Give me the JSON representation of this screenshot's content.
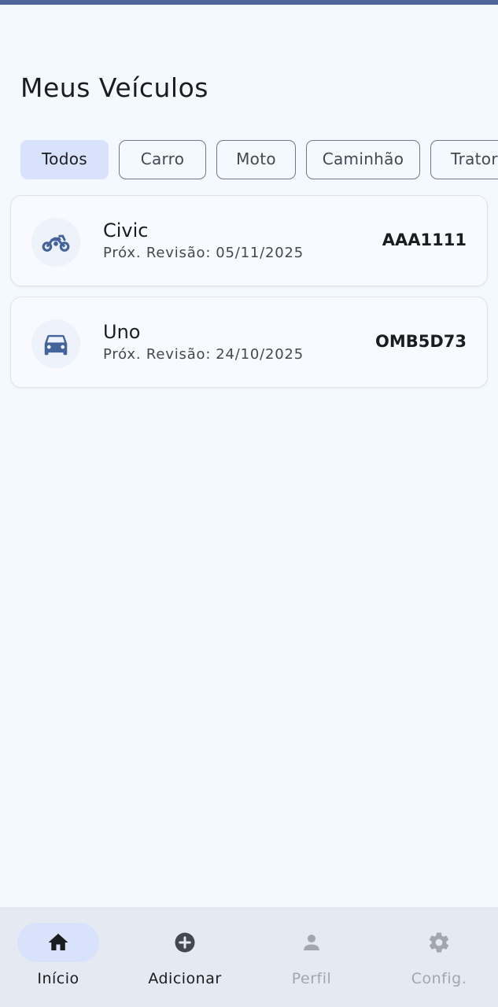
{
  "page": {
    "title": "Meus Veículos"
  },
  "filters": [
    {
      "label": "Todos",
      "selected": true
    },
    {
      "label": "Carro",
      "selected": false
    },
    {
      "label": "Moto",
      "selected": false
    },
    {
      "label": "Caminhão",
      "selected": false
    },
    {
      "label": "Trator",
      "selected": false
    }
  ],
  "vehicles": [
    {
      "name": "Civic",
      "revision_label": "Próx. Revisão:",
      "revision_date": "05/11/2025",
      "plate": "AAA1111",
      "icon": "motorcycle-icon"
    },
    {
      "name": "Uno",
      "revision_label": "Próx. Revisão:",
      "revision_date": "24/10/2025",
      "plate": "OMB5D73",
      "icon": "car-icon"
    }
  ],
  "bottom_nav": [
    {
      "label": "Início",
      "icon": "home-icon",
      "active": true
    },
    {
      "label": "Adicionar",
      "icon": "add-circle-icon",
      "active": false
    },
    {
      "label": "Perfil",
      "icon": "person-icon",
      "active": false,
      "disabled": true
    },
    {
      "label": "Config.",
      "icon": "gear-icon",
      "active": false,
      "disabled": true
    }
  ],
  "colors": {
    "accent": "#4d6498",
    "background": "#f4f8ff",
    "chip_selected": "#d9e2fb",
    "nav_background": "#e4e9f2"
  }
}
